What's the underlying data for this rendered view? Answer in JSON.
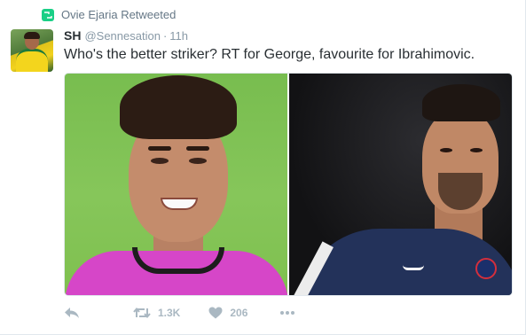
{
  "context": {
    "icon": "retweet-badge-icon",
    "label": "Ovie Ejaria Retweeted"
  },
  "author": {
    "name": "SH",
    "handle": "@Sennesation",
    "separator": "·",
    "time": "11h"
  },
  "tweet": {
    "text": "Who's the better striker? RT for George, favourite for Ibrahimovic."
  },
  "actions": {
    "reply_icon": "reply-icon",
    "retweet_icon": "retweet-icon",
    "retweet_count": "1.3K",
    "like_icon": "heart-icon",
    "like_count": "206",
    "more_icon": "more-icon"
  },
  "colors": {
    "retweet_badge": "#19cf86",
    "muted_text": "#8899a6",
    "action_gray": "#aab8c2"
  }
}
